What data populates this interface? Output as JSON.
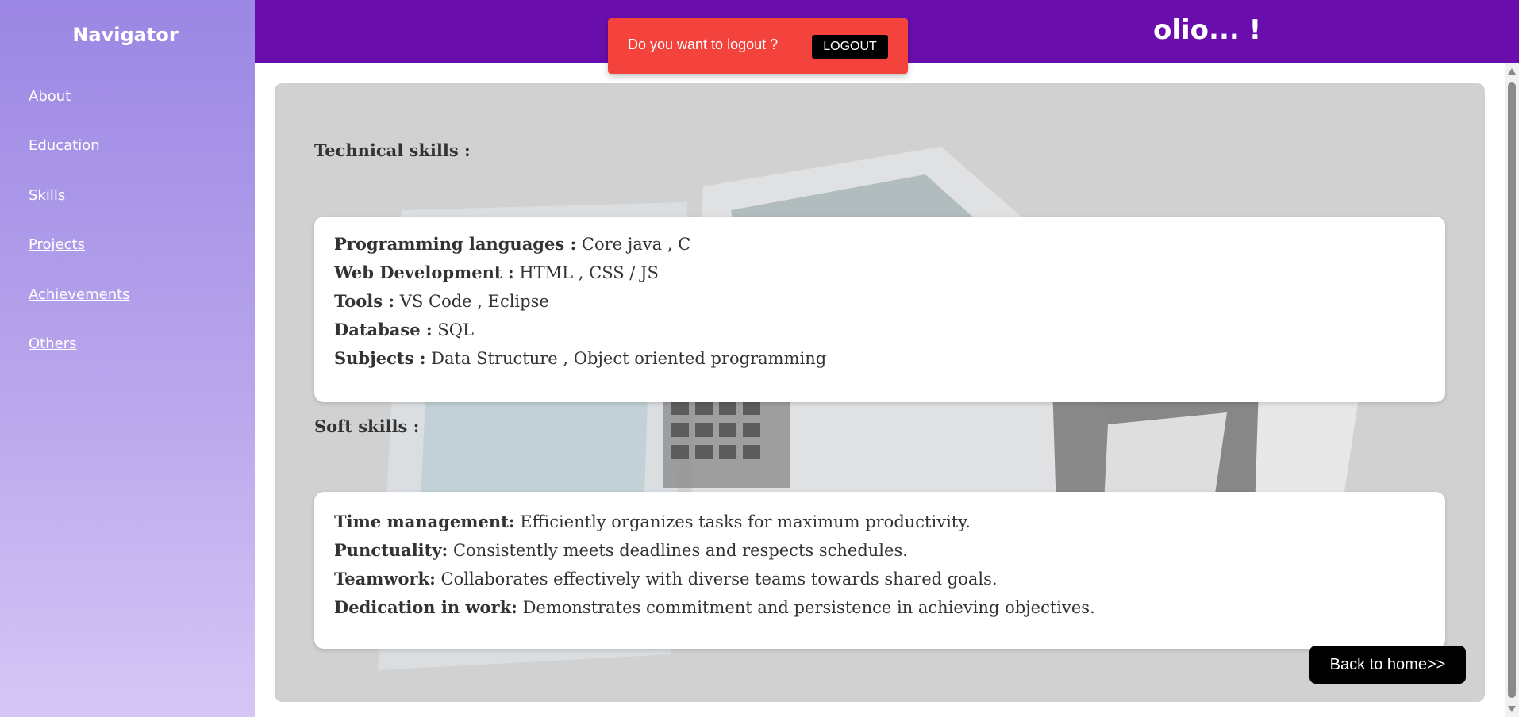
{
  "sidebar": {
    "title": "Navigator",
    "items": [
      {
        "label": "About"
      },
      {
        "label": "Education"
      },
      {
        "label": "Skills"
      },
      {
        "label": "Projects"
      },
      {
        "label": "Achievements"
      },
      {
        "label": "Others"
      }
    ]
  },
  "header": {
    "title_visible": "olio... !"
  },
  "toast": {
    "message": "Do you want to logout ?",
    "button_label": "LOGOUT",
    "color": "#f4433c"
  },
  "technical": {
    "heading": "Technical skills :",
    "rows": [
      {
        "key": "Programming languages :",
        "value": " Core java , C"
      },
      {
        "key": "Web Development :",
        "value": " HTML , CSS / JS"
      },
      {
        "key": "Tools :",
        "value": " VS Code , Eclipse"
      },
      {
        "key": "Database :",
        "value": " SQL"
      },
      {
        "key": "Subjects :",
        "value": " Data Structure , Object oriented programming"
      }
    ]
  },
  "soft": {
    "heading": "Soft skills :",
    "rows": [
      {
        "key": "Time management:",
        "value": " Efficiently organizes tasks for maximum productivity."
      },
      {
        "key": "Punctuality:",
        "value": " Consistently meets deadlines and respects schedules."
      },
      {
        "key": "Teamwork:",
        "value": " Collaborates effectively with diverse teams towards shared goals."
      },
      {
        "key": "Dedication in work:",
        "value": " Demonstrates commitment and persistence in achieving objectives."
      }
    ]
  },
  "back_button": {
    "label": "Back to home>>"
  },
  "colors": {
    "header": "#6a0dad",
    "sidebar_top": "#9b87e4",
    "sidebar_bottom": "#d6c6f6"
  }
}
